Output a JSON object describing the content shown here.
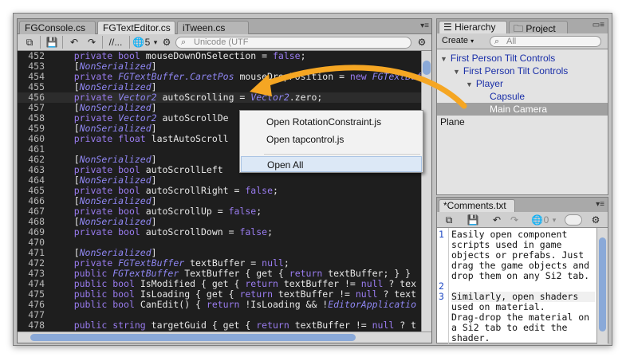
{
  "editor": {
    "tabs": [
      "FGConsole.cs",
      "FGTextEditor.cs",
      "iTween.cs"
    ],
    "active_tab": "FGTextEditor.cs",
    "toolbar": {
      "comment_label": "//...",
      "count_label": "5",
      "encoding_placeholder": "Unicode (UTF"
    },
    "lines": [
      {
        "num": "452",
        "segs": [
          [
            "",
            "    "
          ],
          [
            "kw",
            "private"
          ],
          [
            "",
            " "
          ],
          [
            "kw",
            "bool"
          ],
          [
            "",
            " mouseDownOnSelection = "
          ],
          [
            "kw",
            "false"
          ],
          [
            "",
            ";"
          ]
        ]
      },
      {
        "num": "453",
        "segs": [
          [
            "",
            "    ["
          ],
          [
            "at",
            "NonSerialized"
          ],
          [
            "",
            "]"
          ]
        ]
      },
      {
        "num": "454",
        "segs": [
          [
            "",
            "    "
          ],
          [
            "kw",
            "private"
          ],
          [
            "",
            " "
          ],
          [
            "ty",
            "FGTextBuffer.CaretPos"
          ],
          [
            "",
            " mouseDropPosition = "
          ],
          [
            "kw",
            "new"
          ],
          [
            "",
            " "
          ],
          [
            "ty",
            "FGTextBuffer"
          ]
        ]
      },
      {
        "num": "455",
        "segs": [
          [
            "",
            "    ["
          ],
          [
            "at",
            "NonSerialized"
          ],
          [
            "",
            "]"
          ]
        ]
      },
      {
        "num": "456",
        "segs": [
          [
            "",
            "    "
          ],
          [
            "kw",
            "private"
          ],
          [
            "",
            " "
          ],
          [
            "ty",
            "Vector2"
          ],
          [
            "",
            " autoScrolling = "
          ],
          [
            "ty",
            "Vector2"
          ],
          [
            "",
            ".zero;"
          ]
        ]
      },
      {
        "num": "457",
        "segs": [
          [
            "",
            "    ["
          ],
          [
            "at",
            "NonSerialized"
          ],
          [
            "",
            "]"
          ]
        ]
      },
      {
        "num": "458",
        "segs": [
          [
            "",
            "    "
          ],
          [
            "kw",
            "private"
          ],
          [
            "",
            " "
          ],
          [
            "ty",
            "Vector2"
          ],
          [
            "",
            " autoScrollDe"
          ]
        ]
      },
      {
        "num": "459",
        "segs": [
          [
            "",
            "    ["
          ],
          [
            "at",
            "NonSerialized"
          ],
          [
            "",
            "]"
          ]
        ]
      },
      {
        "num": "460",
        "segs": [
          [
            "",
            "    "
          ],
          [
            "kw",
            "private"
          ],
          [
            "",
            " "
          ],
          [
            "kw",
            "float"
          ],
          [
            "",
            " lastAutoScroll"
          ]
        ]
      },
      {
        "num": "461",
        "segs": [
          [
            "",
            ""
          ]
        ]
      },
      {
        "num": "462",
        "segs": [
          [
            "",
            "    ["
          ],
          [
            "at",
            "NonSerialized"
          ],
          [
            "",
            "]"
          ]
        ]
      },
      {
        "num": "463",
        "segs": [
          [
            "",
            "    "
          ],
          [
            "kw",
            "private"
          ],
          [
            "",
            " "
          ],
          [
            "kw",
            "bool"
          ],
          [
            "",
            " autoScrollLeft"
          ]
        ]
      },
      {
        "num": "464",
        "segs": [
          [
            "",
            "    ["
          ],
          [
            "at",
            "NonSerialized"
          ],
          [
            "",
            "]"
          ]
        ]
      },
      {
        "num": "465",
        "segs": [
          [
            "",
            "    "
          ],
          [
            "kw",
            "private"
          ],
          [
            "",
            " "
          ],
          [
            "kw",
            "bool"
          ],
          [
            "",
            " autoScrollRight = "
          ],
          [
            "kw",
            "false"
          ],
          [
            "",
            ";"
          ]
        ]
      },
      {
        "num": "466",
        "segs": [
          [
            "",
            "    ["
          ],
          [
            "at",
            "NonSerialized"
          ],
          [
            "",
            "]"
          ]
        ]
      },
      {
        "num": "467",
        "segs": [
          [
            "",
            "    "
          ],
          [
            "kw",
            "private"
          ],
          [
            "",
            " "
          ],
          [
            "kw",
            "bool"
          ],
          [
            "",
            " autoScrollUp = "
          ],
          [
            "kw",
            "false"
          ],
          [
            "",
            ";"
          ]
        ]
      },
      {
        "num": "468",
        "segs": [
          [
            "",
            "    ["
          ],
          [
            "at",
            "NonSerialized"
          ],
          [
            "",
            "]"
          ]
        ]
      },
      {
        "num": "469",
        "segs": [
          [
            "",
            "    "
          ],
          [
            "kw",
            "private"
          ],
          [
            "",
            " "
          ],
          [
            "kw",
            "bool"
          ],
          [
            "",
            " autoScrollDown = "
          ],
          [
            "kw",
            "false"
          ],
          [
            "",
            ";"
          ]
        ]
      },
      {
        "num": "470",
        "segs": [
          [
            "",
            ""
          ]
        ]
      },
      {
        "num": "471",
        "segs": [
          [
            "",
            "    ["
          ],
          [
            "at",
            "NonSerialized"
          ],
          [
            "",
            "]"
          ]
        ]
      },
      {
        "num": "472",
        "segs": [
          [
            "",
            "    "
          ],
          [
            "kw",
            "private"
          ],
          [
            "",
            " "
          ],
          [
            "ty",
            "FGTextBuffer"
          ],
          [
            "",
            " textBuffer = "
          ],
          [
            "kw",
            "null"
          ],
          [
            "",
            ";"
          ]
        ]
      },
      {
        "num": "473",
        "segs": [
          [
            "",
            "    "
          ],
          [
            "kw",
            "public"
          ],
          [
            "",
            " "
          ],
          [
            "ty",
            "FGTextBuffer"
          ],
          [
            "",
            " TextBuffer { get { "
          ],
          [
            "kw",
            "return"
          ],
          [
            "",
            " textBuffer; } }"
          ]
        ]
      },
      {
        "num": "474",
        "segs": [
          [
            "",
            "    "
          ],
          [
            "kw",
            "public"
          ],
          [
            "",
            " "
          ],
          [
            "kw",
            "bool"
          ],
          [
            "",
            " IsModified { get { "
          ],
          [
            "kw",
            "return"
          ],
          [
            "",
            " textBuffer != "
          ],
          [
            "kw",
            "null"
          ],
          [
            "",
            " ? tex"
          ]
        ]
      },
      {
        "num": "475",
        "segs": [
          [
            "",
            "    "
          ],
          [
            "kw",
            "public"
          ],
          [
            "",
            " "
          ],
          [
            "kw",
            "bool"
          ],
          [
            "",
            " IsLoading { get { "
          ],
          [
            "kw",
            "return"
          ],
          [
            "",
            " textBuffer != "
          ],
          [
            "kw",
            "null"
          ],
          [
            "",
            " ? text"
          ]
        ]
      },
      {
        "num": "476",
        "segs": [
          [
            "",
            "    "
          ],
          [
            "kw",
            "public"
          ],
          [
            "",
            " "
          ],
          [
            "kw",
            "bool"
          ],
          [
            "",
            " CanEdit() { "
          ],
          [
            "kw",
            "return"
          ],
          [
            "",
            " !IsLoading && !"
          ],
          [
            "ty",
            "EditorApplicatio"
          ]
        ]
      },
      {
        "num": "477",
        "segs": [
          [
            "",
            ""
          ]
        ]
      },
      {
        "num": "478",
        "segs": [
          [
            "",
            "    "
          ],
          [
            "kw",
            "public"
          ],
          [
            "",
            " "
          ],
          [
            "kw",
            "string"
          ],
          [
            "",
            " targetGuid { get { "
          ],
          [
            "kw",
            "return"
          ],
          [
            "",
            " textBuffer != "
          ],
          [
            "kw",
            "null"
          ],
          [
            "",
            " ? t"
          ]
        ]
      }
    ]
  },
  "context_menu": {
    "items": [
      "Open RotationConstraint.js",
      "Open tapcontrol.js",
      "Open All"
    ],
    "selected": "Open All"
  },
  "hierarchy": {
    "tabs": [
      "Hierarchy",
      "Project"
    ],
    "create_label": "Create",
    "search_placeholder": "All",
    "items": [
      {
        "label": "First Person Tilt Controls",
        "depth": 0,
        "expanded": true
      },
      {
        "label": "First Person Tilt Controls",
        "depth": 1,
        "expanded": true
      },
      {
        "label": "Player",
        "depth": 2,
        "expanded": true
      },
      {
        "label": "Capsule",
        "depth": 3
      },
      {
        "label": "Main Camera",
        "depth": 3,
        "selected": true
      },
      {
        "label": "Plane",
        "depth": 0,
        "plain": true
      }
    ]
  },
  "comments": {
    "tab": "*Comments.txt",
    "count_label": "0",
    "lines": [
      {
        "num": "1",
        "text": "Easily open component"
      },
      {
        "num": "",
        "text": "scripts used in game"
      },
      {
        "num": "",
        "text": "objects or prefabs. Just"
      },
      {
        "num": "",
        "text": "drag the game objects and"
      },
      {
        "num": "",
        "text": "drop them on any Si2 tab."
      },
      {
        "num": "2",
        "text": ""
      },
      {
        "num": "3",
        "text": "Similarly, open shaders"
      },
      {
        "num": "",
        "text": "used on material."
      },
      {
        "num": "",
        "text": "Drag-drop the material on"
      },
      {
        "num": "",
        "text": "a Si2 tab to edit the"
      },
      {
        "num": "",
        "text": "shader."
      }
    ]
  },
  "colors": {
    "arrow": "#f5a623",
    "keyword": "#9a7cf0",
    "hierarchy_link": "#1a2fa8",
    "selection": "#a0a0a0"
  }
}
